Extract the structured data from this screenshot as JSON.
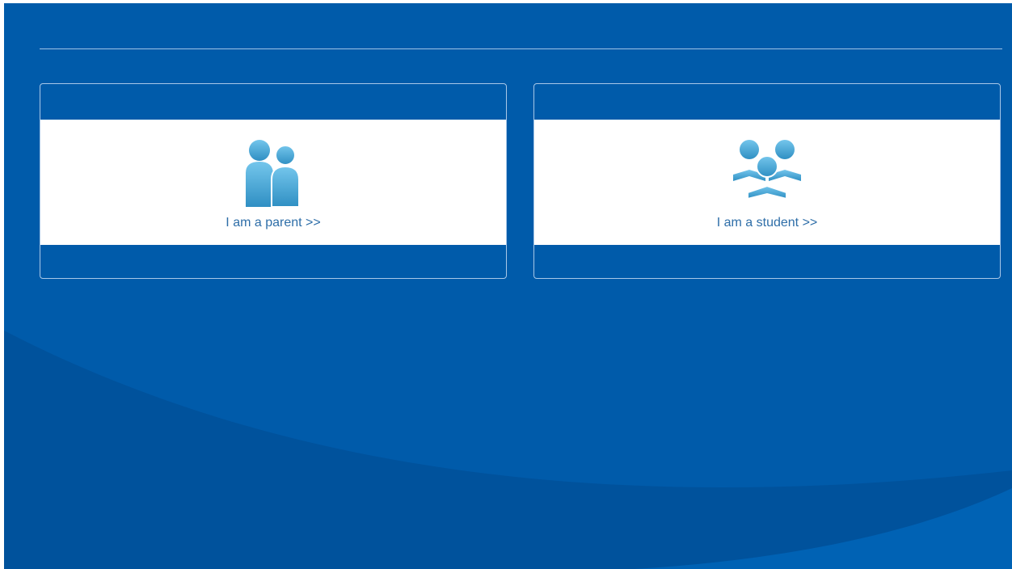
{
  "colors": {
    "background": "#005baa",
    "wave": "#00529c",
    "card_band": "#ffffff",
    "link_text": "#2e6ea8",
    "icon_light": "#6cc0e8",
    "icon_dark": "#2f8fc3"
  },
  "cards": [
    {
      "label": "I am a parent >>",
      "icon": "parents-icon"
    },
    {
      "label": "I am a student >>",
      "icon": "students-icon"
    }
  ]
}
